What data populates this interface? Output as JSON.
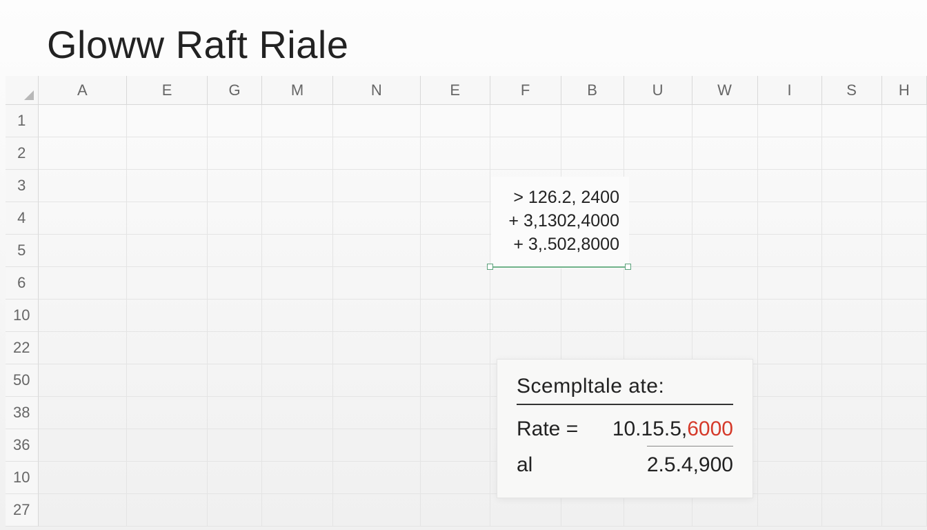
{
  "title": "Gloww Raft Riale",
  "columns": [
    "A",
    "E",
    "G",
    "M",
    "N",
    "E",
    "F",
    "B",
    "U",
    "W",
    "I",
    "S",
    "H"
  ],
  "rows": [
    "1",
    "2",
    "3",
    "4",
    "5",
    "6",
    "10",
    "22",
    "50",
    "38",
    "36",
    "10",
    "27"
  ],
  "calc": {
    "line1": "> 126.2, 2400",
    "line2": "+ 3,1302,4000",
    "line3": "+ 3,.502,8000"
  },
  "card": {
    "title": "Scempltale ate:",
    "rate_label": "Rate  =",
    "rate_value_black": "10.15.5,",
    "rate_value_red": "6000",
    "al_label": "al",
    "al_value": "2.5.4,900"
  }
}
